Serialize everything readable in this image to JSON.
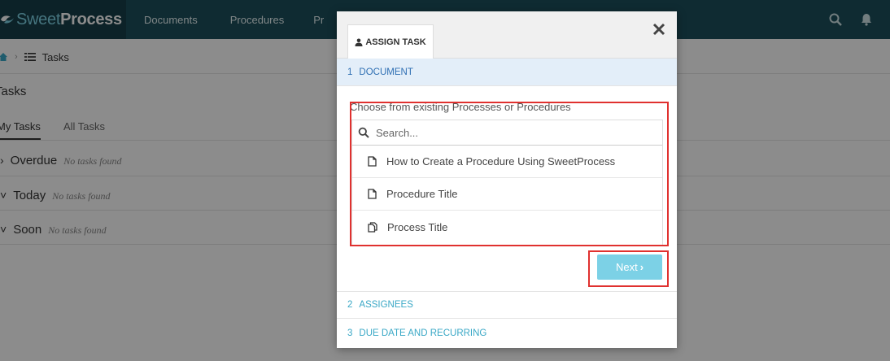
{
  "nav": {
    "brand_light": "Sweet",
    "brand_bold": "Process",
    "links": [
      "Documents",
      "Procedures",
      "Pr"
    ],
    "colors": {
      "bar": "#1d4f5b",
      "brand_bg": "#163f49",
      "brand_light": "#7fd3e6"
    }
  },
  "page": {
    "breadcrumb": "Tasks",
    "title": "Tasks",
    "tabs": [
      "My Tasks",
      "All Tasks"
    ],
    "groups": [
      {
        "name": "Overdue",
        "empty": "No tasks found"
      },
      {
        "name": "Today",
        "empty": "No tasks found"
      },
      {
        "name": "Soon",
        "empty": "No tasks found"
      }
    ]
  },
  "modal": {
    "tab_label": "ASSIGN TASK",
    "steps": [
      {
        "num": "1",
        "label": "DOCUMENT"
      },
      {
        "num": "2",
        "label": "ASSIGNEES"
      },
      {
        "num": "3",
        "label": "DUE DATE AND RECURRING"
      }
    ],
    "choose_label": "Choose from existing Processes or Procedures",
    "search_placeholder": "Search...",
    "items": [
      {
        "label": "How to Create a Procedure Using SweetProcess",
        "icon": "document-icon"
      },
      {
        "label": "Procedure Title",
        "icon": "document-icon"
      },
      {
        "label": "Process Title",
        "icon": "copy-documents-icon"
      }
    ],
    "next_label": "Next",
    "colors": {
      "accent": "#3aa8c6",
      "active_step_bg": "#e3eef9",
      "next_button": "#7cd1e6",
      "annotation": "#e0312f"
    }
  }
}
